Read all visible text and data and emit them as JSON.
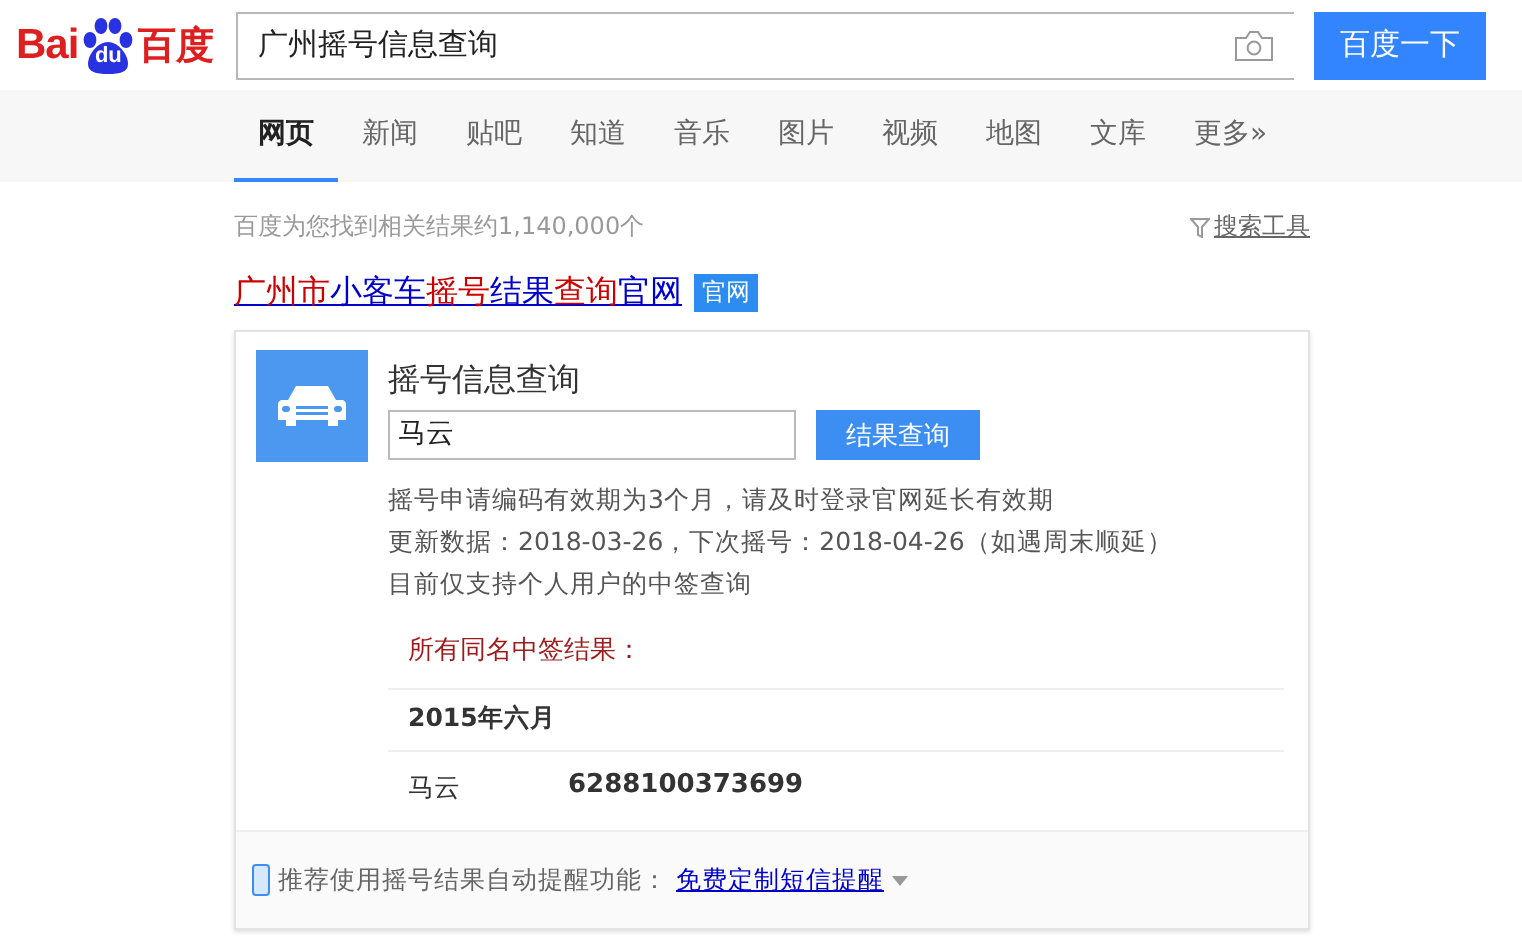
{
  "logo": {
    "left": "Bai",
    "paw": "du",
    "right": "百度"
  },
  "search": {
    "value": "广州摇号信息查询",
    "button": "百度一下"
  },
  "tabs": [
    {
      "label": "网页",
      "selected": true
    },
    {
      "label": "新闻",
      "selected": false
    },
    {
      "label": "贴吧",
      "selected": false
    },
    {
      "label": "知道",
      "selected": false
    },
    {
      "label": "音乐",
      "selected": false
    },
    {
      "label": "图片",
      "selected": false
    },
    {
      "label": "视频",
      "selected": false
    },
    {
      "label": "地图",
      "selected": false
    },
    {
      "label": "文库",
      "selected": false
    },
    {
      "label": "更多»",
      "selected": false
    }
  ],
  "result_count": "百度为您找到相关结果约1,140,000个",
  "search_tools": "搜索工具",
  "result": {
    "title_segments": [
      {
        "text": "广州市",
        "highlighted": true
      },
      {
        "text": "小客车",
        "highlighted": false
      },
      {
        "text": "摇号",
        "highlighted": true
      },
      {
        "text": "结果",
        "highlighted": false
      },
      {
        "text": "查询",
        "highlighted": true
      },
      {
        "text": "官网",
        "highlighted": false
      }
    ],
    "badge": "官网",
    "card": {
      "heading": "摇号信息查询",
      "input_value": "马云",
      "button": "结果查询",
      "notes": [
        "摇号申请编码有效期为3个月，请及时登录官网延长有效期",
        "更新数据：2018-03-26，下次摇号：2018-04-26（如遇周末顺延）",
        "目前仅支持个人用户的中签查询"
      ],
      "results_label": "所有同名中签结果：",
      "groups": [
        {
          "month": "2015年六月",
          "rows": [
            {
              "name": "马云",
              "code": "6288100373699"
            }
          ]
        }
      ],
      "footer_text": "推荐使用摇号结果自动提醒功能：",
      "footer_link": "免费定制短信提醒"
    }
  }
}
